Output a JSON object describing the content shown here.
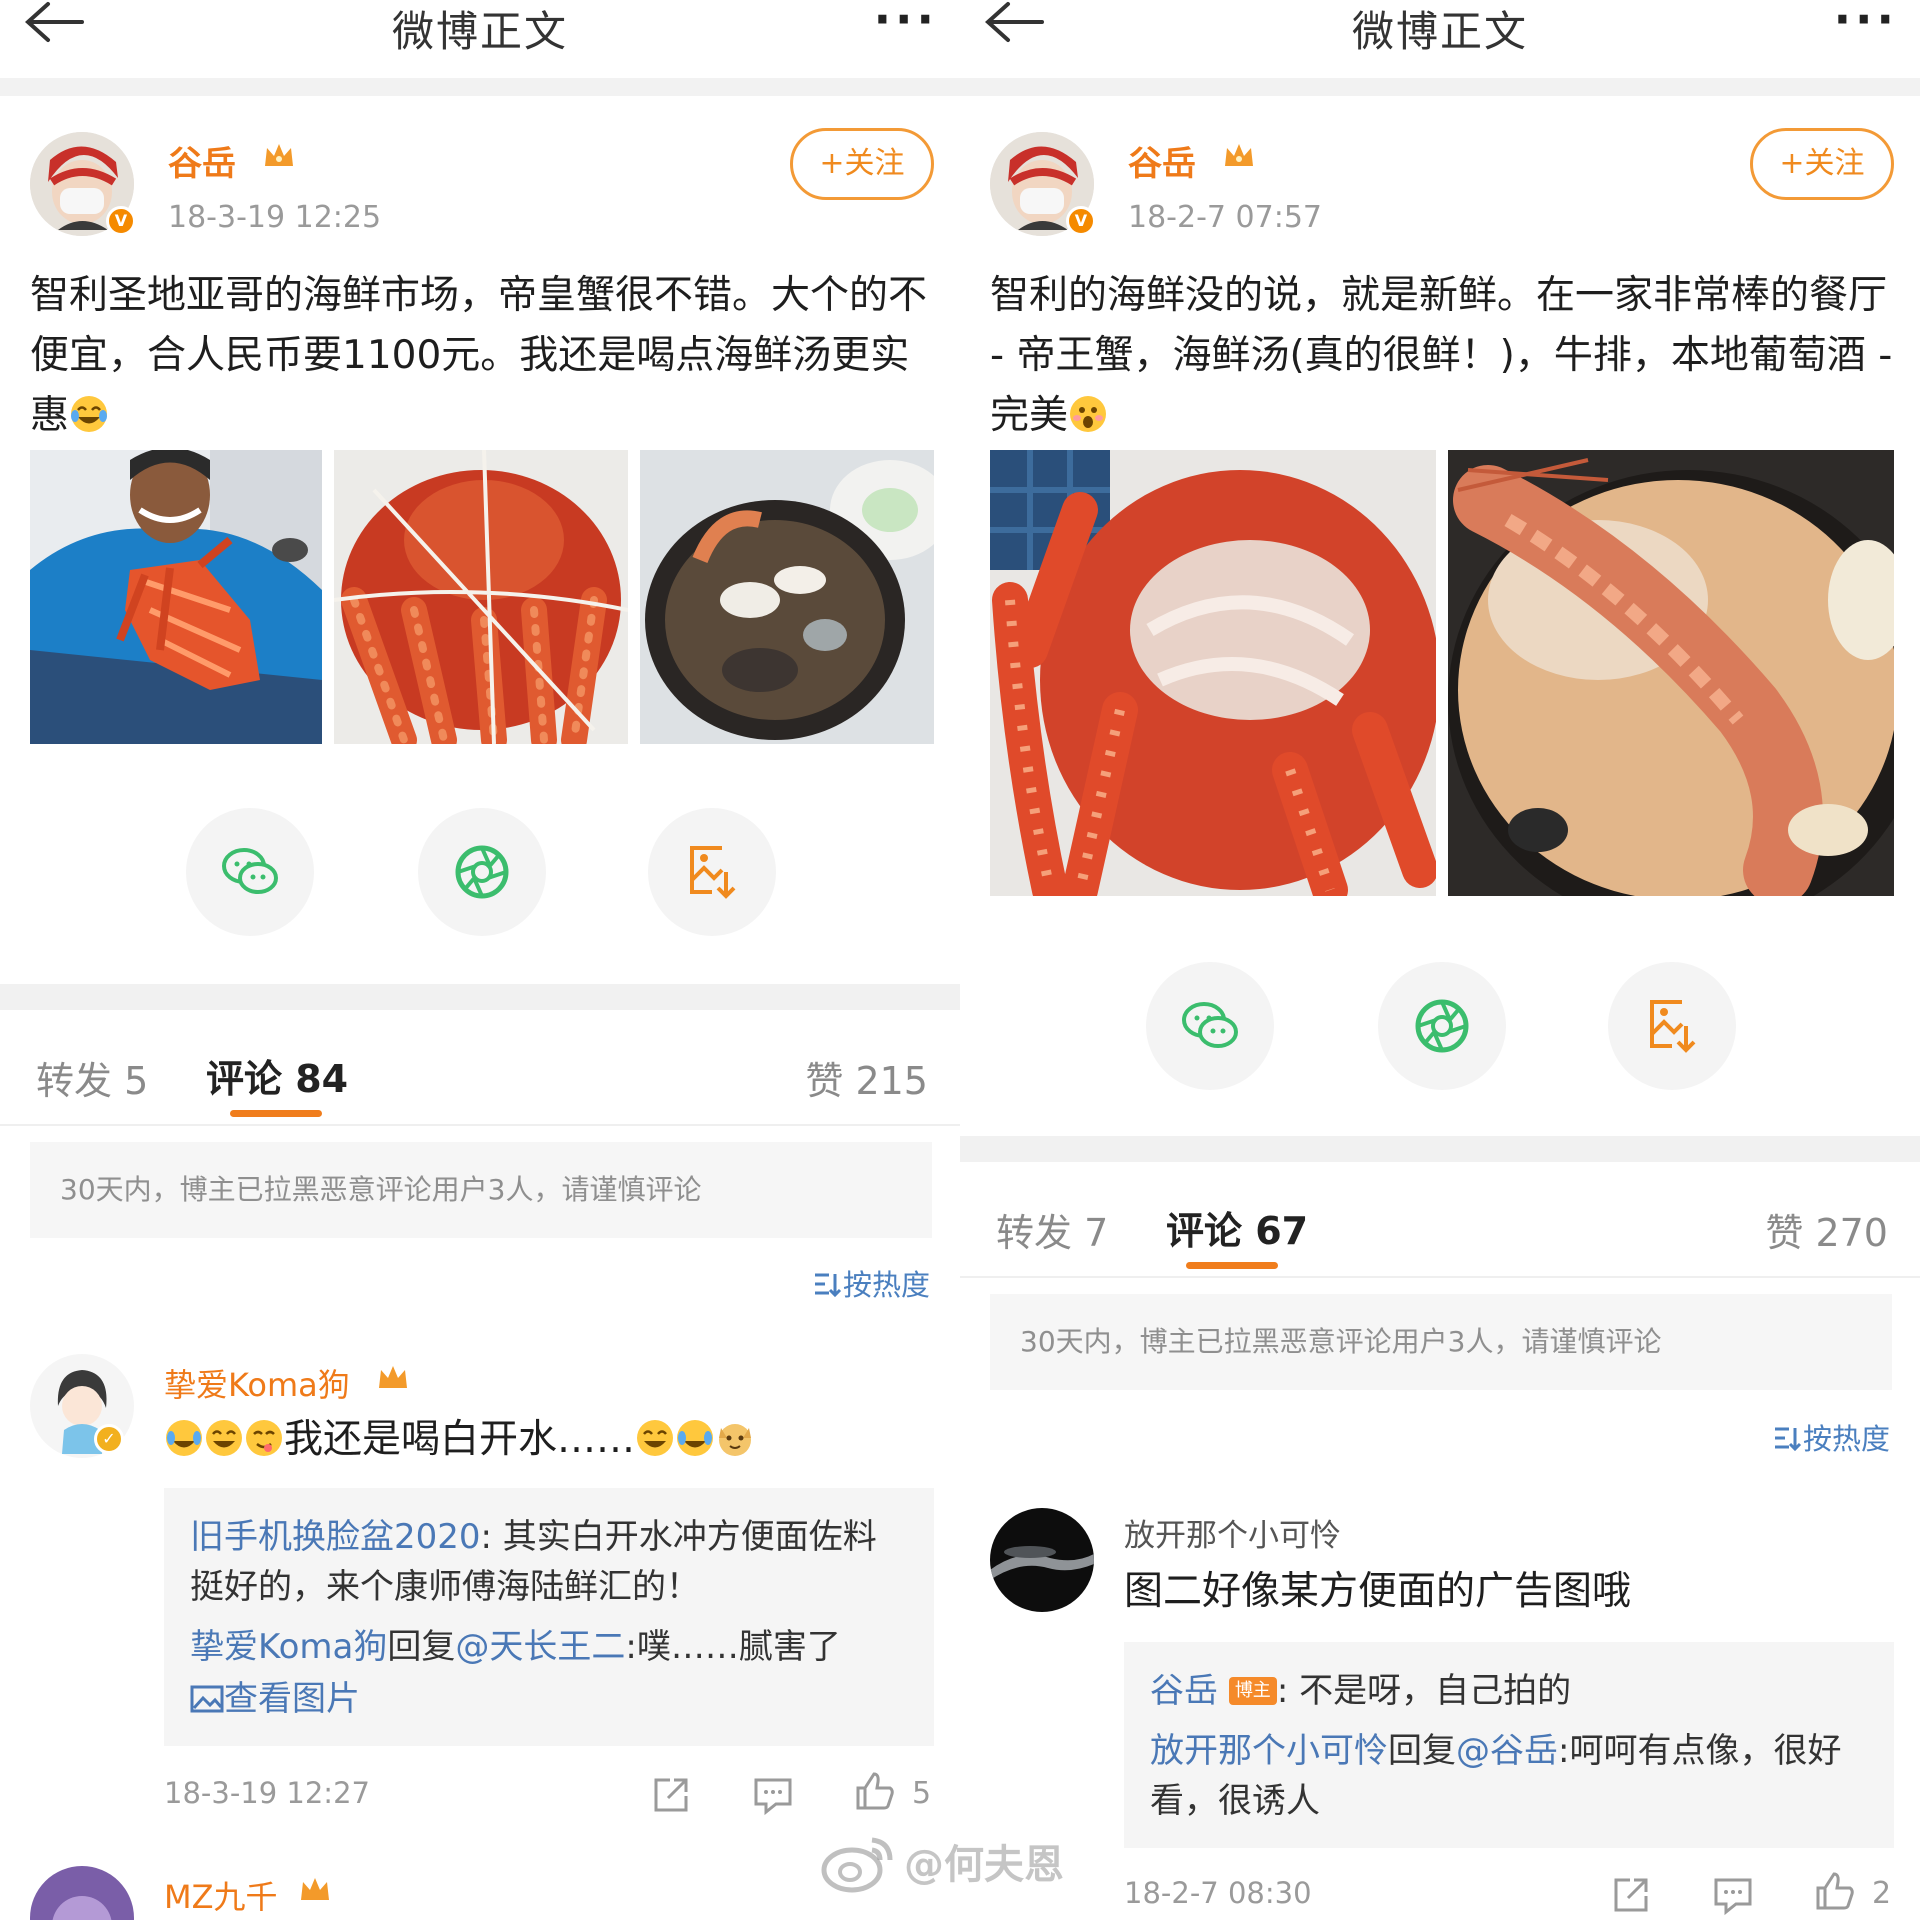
{
  "left": {
    "header": {
      "title": "微博正文",
      "more": "···"
    },
    "post": {
      "author": "谷岳",
      "time": "18-3-19 12:25",
      "follow_label": "+关注",
      "text": "智利圣地亚哥的海鲜市场，帝皇蟹很不错。大个的不便宜，合人民币要1100元。我还是喝点海鲜汤更实惠",
      "text_emoji": "laugh-cry-emoji",
      "photos": [
        "man-holding-king-crab-photo",
        "tied-king-crab-photo",
        "seafood-soup-pot-photo"
      ]
    },
    "share": [
      "wechat-icon",
      "moments-icon",
      "save-image-icon"
    ],
    "tabs": {
      "repost": "转发 5",
      "comments": "评论 84",
      "likes": "赞 215"
    },
    "notice": "30天内，博主已拉黑恶意评论用户3人，请谨慎评论",
    "sort": "按热度",
    "comment": {
      "user": "挚爱Koma狗",
      "text": "我还是喝白开水……",
      "reply1_user": "旧手机换脸盆2020",
      "reply1_text": ": 其实白开水冲方便面佐料挺好的，来个康师傅海陆鲜汇的！",
      "reply2_user": "挚爱Koma狗",
      "reply2_mid": "回复",
      "reply2_at": "@天长王二",
      "reply2_text": ":噗……腻害了",
      "view_image": "查看图片",
      "time": "18-3-19 12:27",
      "like_count": "5"
    },
    "next_user": "MZ九千"
  },
  "right": {
    "header": {
      "title": "微博正文",
      "more": "···"
    },
    "post": {
      "author": "谷岳",
      "time": "18-2-7 07:57",
      "follow_label": "+关注",
      "text": "智利的海鲜没的说，就是新鲜。在一家非常棒的餐厅 - 帝王蟹，海鲜汤(真的很鲜！)，牛排，本地葡萄酒 - 完美",
      "text_emoji": "surprised-emoji",
      "photos": [
        "king-crab-plate-photo",
        "shrimp-soup-photo"
      ]
    },
    "share": [
      "wechat-icon",
      "moments-icon",
      "save-image-icon"
    ],
    "tabs": {
      "repost": "转发 7",
      "comments": "评论 67",
      "likes": "赞 270"
    },
    "notice": "30天内，博主已拉黑恶意评论用户3人，请谨慎评论",
    "sort": "按热度",
    "comment": {
      "user": "放开那个小可怜",
      "text": "图二好像某方便面的广告图哦",
      "reply1_user": "谷岳",
      "reply1_badge": "博主",
      "reply1_text": ": 不是呀，自己拍的",
      "reply2_user": "放开那个小可怜",
      "reply2_mid": "回复",
      "reply2_at": "@谷岳",
      "reply2_text": ":呵呵有点像，很好看，很诱人",
      "time": "18-2-7 08:30",
      "like_count": "2"
    }
  },
  "watermark": "@何夫恩",
  "colors": {
    "accent": "#f07d1c",
    "link": "#4a78b6",
    "divider": "#f1f1f1"
  }
}
